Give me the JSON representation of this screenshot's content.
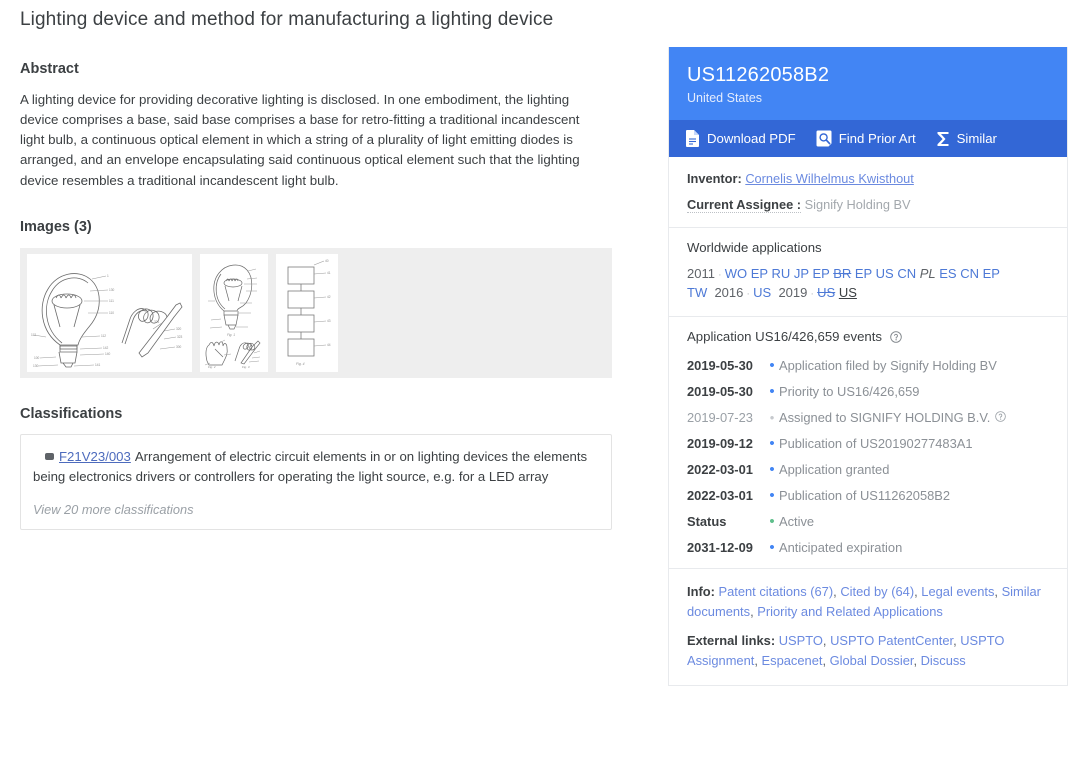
{
  "document": {
    "title": "Lighting device and method for manufacturing a lighting device",
    "abstract_heading": "Abstract",
    "abstract_text": "A lighting device for providing decorative lighting is disclosed. In one embodiment, the lighting device comprises a base, said base comprises a base for retro-fitting a traditional incandescent light bulb, a continuous optical element in which a string of a plurality of light emitting diodes is arranged, and an envelope encapsulating said continuous optical element such that the lighting device resembles a traditional incandescent light bulb.",
    "images_heading": "Images (3)",
    "image_count": 3,
    "classifications_heading": "Classifications",
    "classifications": [
      {
        "code": "F21V23/003",
        "description": "Arrangement of electric circuit elements in or on lighting devices the elements being electronics drivers or controllers for operating the light source, e.g. for a LED array"
      }
    ],
    "classifications_more_label": "View 20 more classifications"
  },
  "panel": {
    "publication_number": "US11262058B2",
    "country": "United States",
    "actions": [
      {
        "label": "Download PDF",
        "icon": "document-icon"
      },
      {
        "label": "Find Prior Art",
        "icon": "search-document-icon"
      },
      {
        "label": "Similar",
        "icon": "sigma-icon"
      }
    ],
    "meta": {
      "inventor_label": "Inventor:",
      "inventor_value": "Cornelis Wilhelmus Kwisthout",
      "assignee_label": "Current Assignee :",
      "assignee_value": "Signify Holding BV"
    },
    "worldwide": {
      "heading": "Worldwide applications",
      "groups": [
        {
          "year": "2011",
          "codes": [
            {
              "cc": "WO",
              "style": "link"
            },
            {
              "cc": "EP",
              "style": "link"
            },
            {
              "cc": "RU",
              "style": "link"
            },
            {
              "cc": "JP",
              "style": "link"
            },
            {
              "cc": "EP",
              "style": "link"
            },
            {
              "cc": "BR",
              "style": "strike"
            },
            {
              "cc": "EP",
              "style": "link"
            },
            {
              "cc": "US",
              "style": "link"
            },
            {
              "cc": "CN",
              "style": "link"
            },
            {
              "cc": "PL",
              "style": "italic"
            },
            {
              "cc": "ES",
              "style": "link"
            },
            {
              "cc": "CN",
              "style": "link"
            },
            {
              "cc": "EP",
              "style": "link"
            },
            {
              "cc": "TW",
              "style": "link"
            }
          ]
        },
        {
          "year": "2016",
          "codes": [
            {
              "cc": "US",
              "style": "link"
            }
          ]
        },
        {
          "year": "2019",
          "codes": [
            {
              "cc": "US",
              "style": "strike"
            },
            {
              "cc": "US",
              "style": "underline"
            }
          ]
        }
      ]
    },
    "events": {
      "heading": "Application US16/426,659 events",
      "help_icon": "help-icon",
      "rows": [
        {
          "date": "2019-05-30",
          "dot": "blue",
          "text": "Application filed by Signify Holding BV",
          "muted_date": false,
          "help": false
        },
        {
          "date": "2019-05-30",
          "dot": "blue",
          "text": "Priority to US16/426,659",
          "muted_date": false,
          "help": false
        },
        {
          "date": "2019-07-23",
          "dot": "grey",
          "text": "Assigned to SIGNIFY HOLDING B.V.",
          "muted_date": true,
          "help": true
        },
        {
          "date": "2019-09-12",
          "dot": "blue",
          "text": "Publication of US20190277483A1",
          "muted_date": false,
          "help": false
        },
        {
          "date": "2022-03-01",
          "dot": "blue",
          "text": "Application granted",
          "muted_date": false,
          "help": false
        },
        {
          "date": "2022-03-01",
          "dot": "blue",
          "text": "Publication of US11262058B2",
          "muted_date": false,
          "help": false
        },
        {
          "date": "Status",
          "dot": "green",
          "text": "Active",
          "muted_date": false,
          "help": false
        },
        {
          "date": "2031-12-09",
          "dot": "blue",
          "text": "Anticipated expiration",
          "muted_date": false,
          "help": false
        }
      ]
    },
    "links": {
      "info_label": "Info:",
      "info_links": [
        "Patent citations (67)",
        "Cited by (64)",
        "Legal events",
        "Similar documents",
        "Priority and Related Applications"
      ],
      "external_label": "External links:",
      "external_links": [
        "USPTO",
        "USPTO PatentCenter",
        "USPTO Assignment",
        "Espacenet",
        "Global Dossier",
        "Discuss"
      ]
    }
  },
  "colors": {
    "header_blue": "#4285f4",
    "action_blue": "#3367d6",
    "link_blue": "#6b8ae0",
    "cc_blue": "#4d79d6",
    "status_green": "#5fbf8c",
    "text": "#3c4043",
    "muted": "#9aa0a6",
    "strip_bg": "#eeeeee"
  }
}
